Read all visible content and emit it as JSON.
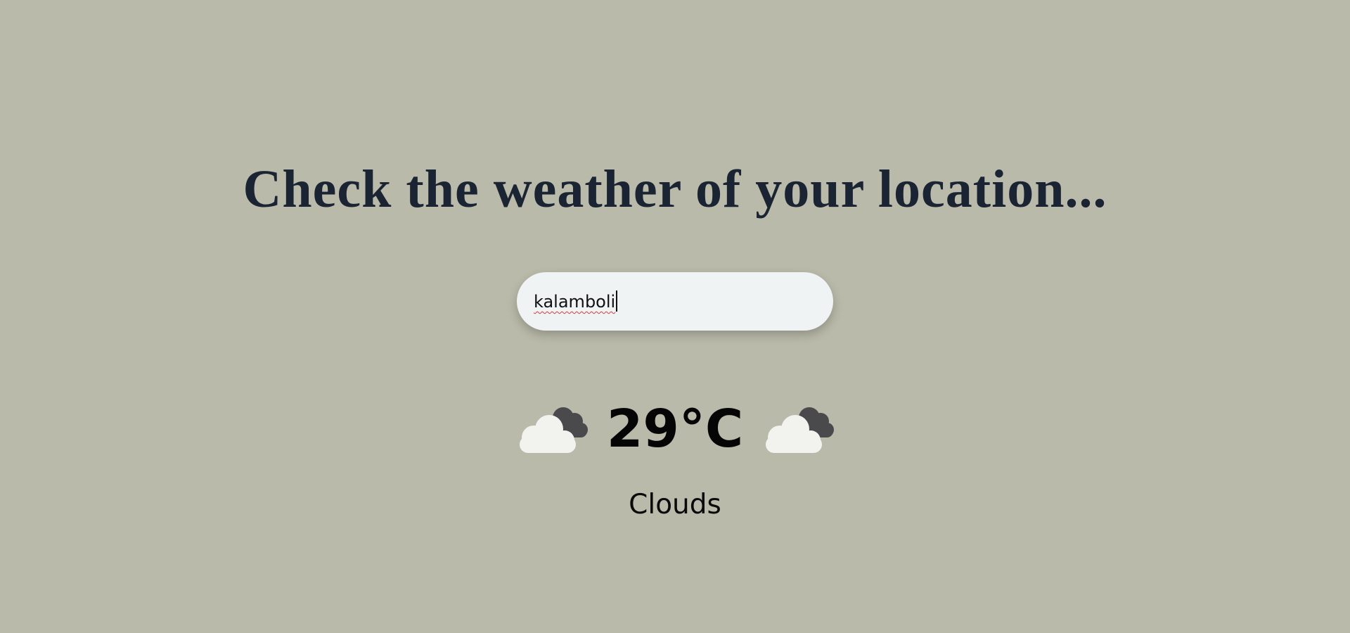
{
  "header": {
    "title": "Check the weather of your location..."
  },
  "search": {
    "value": "kalamboli",
    "placeholder": ""
  },
  "weather": {
    "temperature": "29°C",
    "condition": "Clouds",
    "icon_left": "cloud-icon",
    "icon_right": "cloud-icon"
  },
  "colors": {
    "background": "#b9baa9",
    "title": "#1b2433",
    "input_bg": "#eff3f4"
  }
}
